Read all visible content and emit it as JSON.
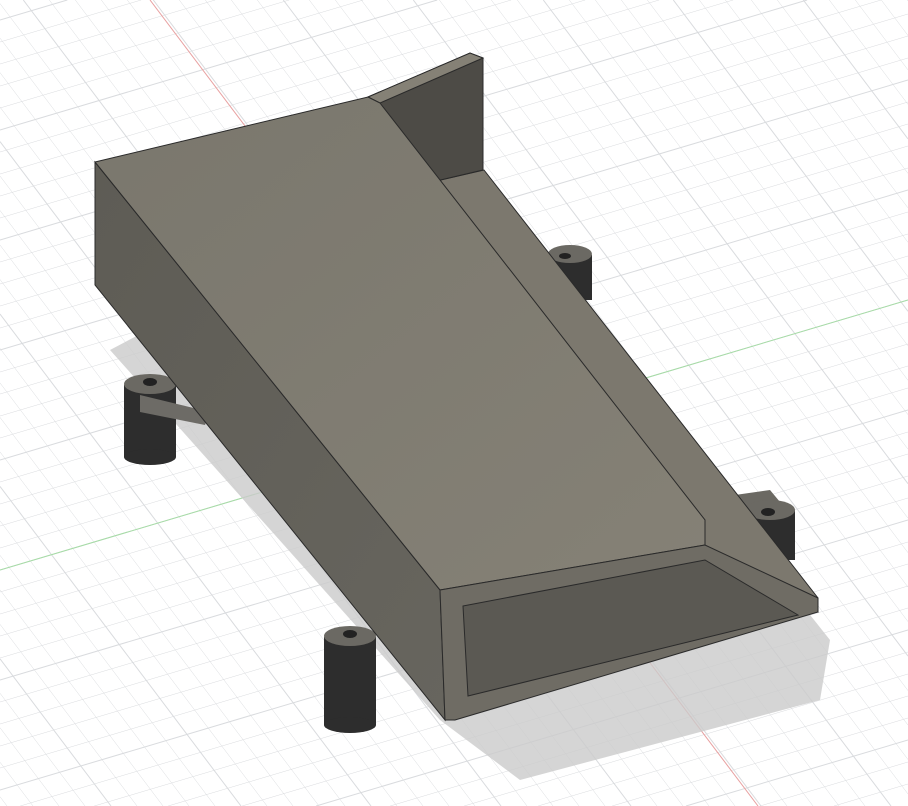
{
  "viewport": {
    "background": "#ffffff",
    "grid_color": "#d9dbde",
    "axis_x_color": "#e8a0a0",
    "axis_y_color": "#a6dca6"
  },
  "model": {
    "body_color": "#7e7a70",
    "side_color": "#5c5a54",
    "inner_color": "#4a4843",
    "post_color": "#2e2e2e",
    "shadow_color": "#cfcfcf"
  }
}
